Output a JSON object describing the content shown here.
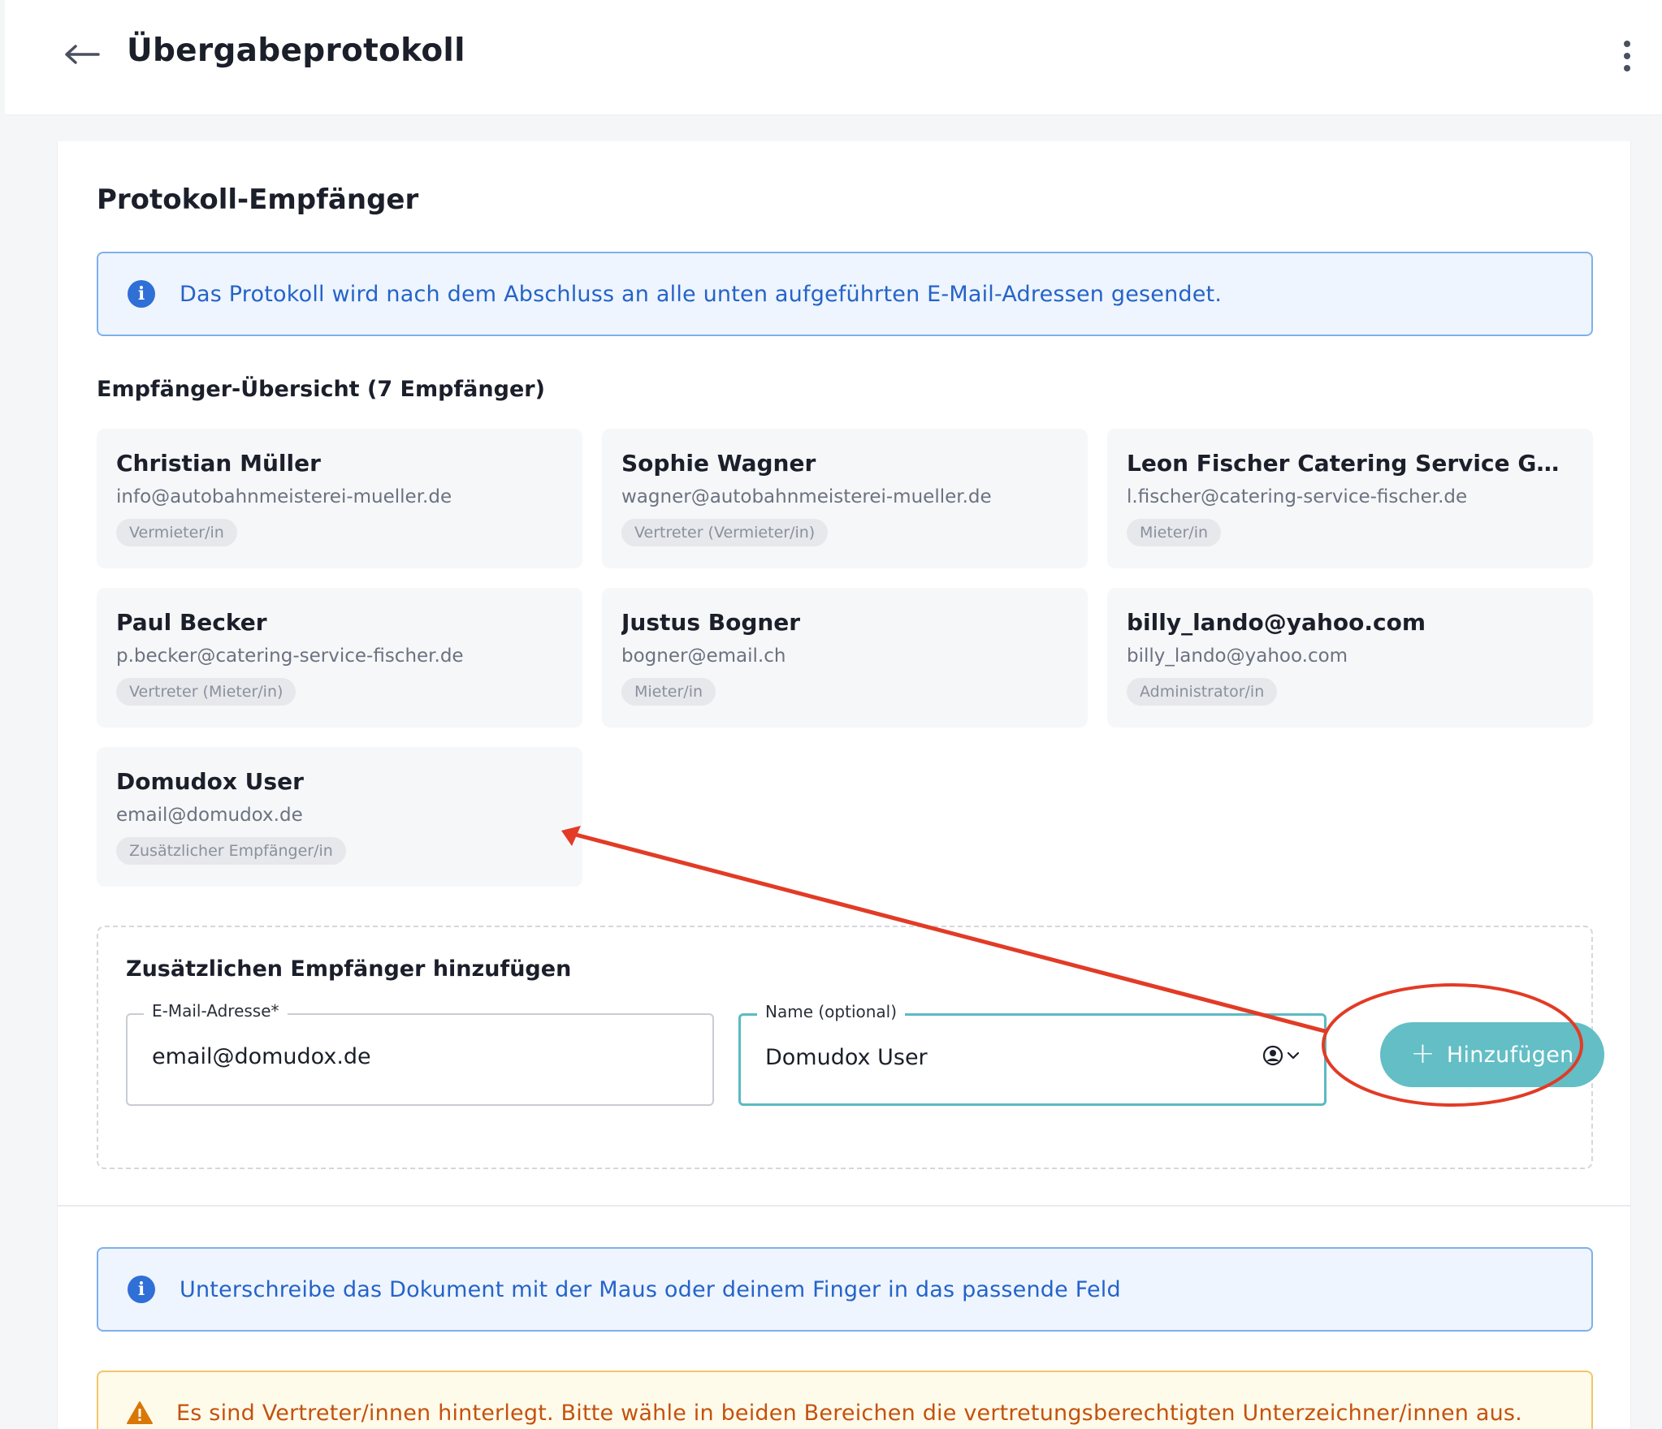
{
  "header": {
    "title": "Übergabeprotokoll",
    "back_icon": "arrow-left-icon",
    "menu_icon": "more-vertical-icon"
  },
  "section": {
    "title": "Protokoll-Empfänger",
    "info": "Das Protokoll wird nach dem Abschluss an alle unten aufgeführten E-Mail-Adressen gesendet.",
    "overview_title": "Empfänger-Übersicht (7 Empfänger)"
  },
  "recipients": [
    {
      "name": "Christian Müller",
      "email": "info@autobahnmeisterei-mueller.de",
      "role": "Vermieter/in"
    },
    {
      "name": "Sophie Wagner",
      "email": "wagner@autobahnmeisterei-mueller.de",
      "role": "Vertreter (Vermieter/in)"
    },
    {
      "name": "Leon Fischer Catering Service GmbH (L...",
      "email": "l.fischer@catering-service-fischer.de",
      "role": "Mieter/in"
    },
    {
      "name": "Paul Becker",
      "email": "p.becker@catering-service-fischer.de",
      "role": "Vertreter (Mieter/in)"
    },
    {
      "name": "Justus Bogner",
      "email": "bogner@email.ch",
      "role": "Mieter/in"
    },
    {
      "name": "billy_lando@yahoo.com",
      "email": "billy_lando@yahoo.com",
      "role": "Administrator/in"
    },
    {
      "name": "Domudox User",
      "email": "email@domudox.de",
      "role": "Zusätzlicher Empfänger/in"
    }
  ],
  "add_form": {
    "title": "Zusätzlichen Empfänger hinzufügen",
    "email_label": "E-Mail-Adresse*",
    "email_value": "email@domudox.de",
    "name_label": "Name (optional)",
    "name_value": "Domudox User",
    "contact_icon": "user-circle-icon",
    "button_label": "Hinzufügen",
    "button_icon": "plus-icon",
    "accent_color": "#63bec5"
  },
  "signature_info": "Unterschreibe das Dokument mit der Maus oder deinem Finger in das passende Feld",
  "warning": "Es sind Vertreter/innen hinterlegt. Bitte wähle in beiden Bereichen die vertretungsberechtigten Unterzeichner/innen aus.",
  "annotation_color": "#e23b26"
}
